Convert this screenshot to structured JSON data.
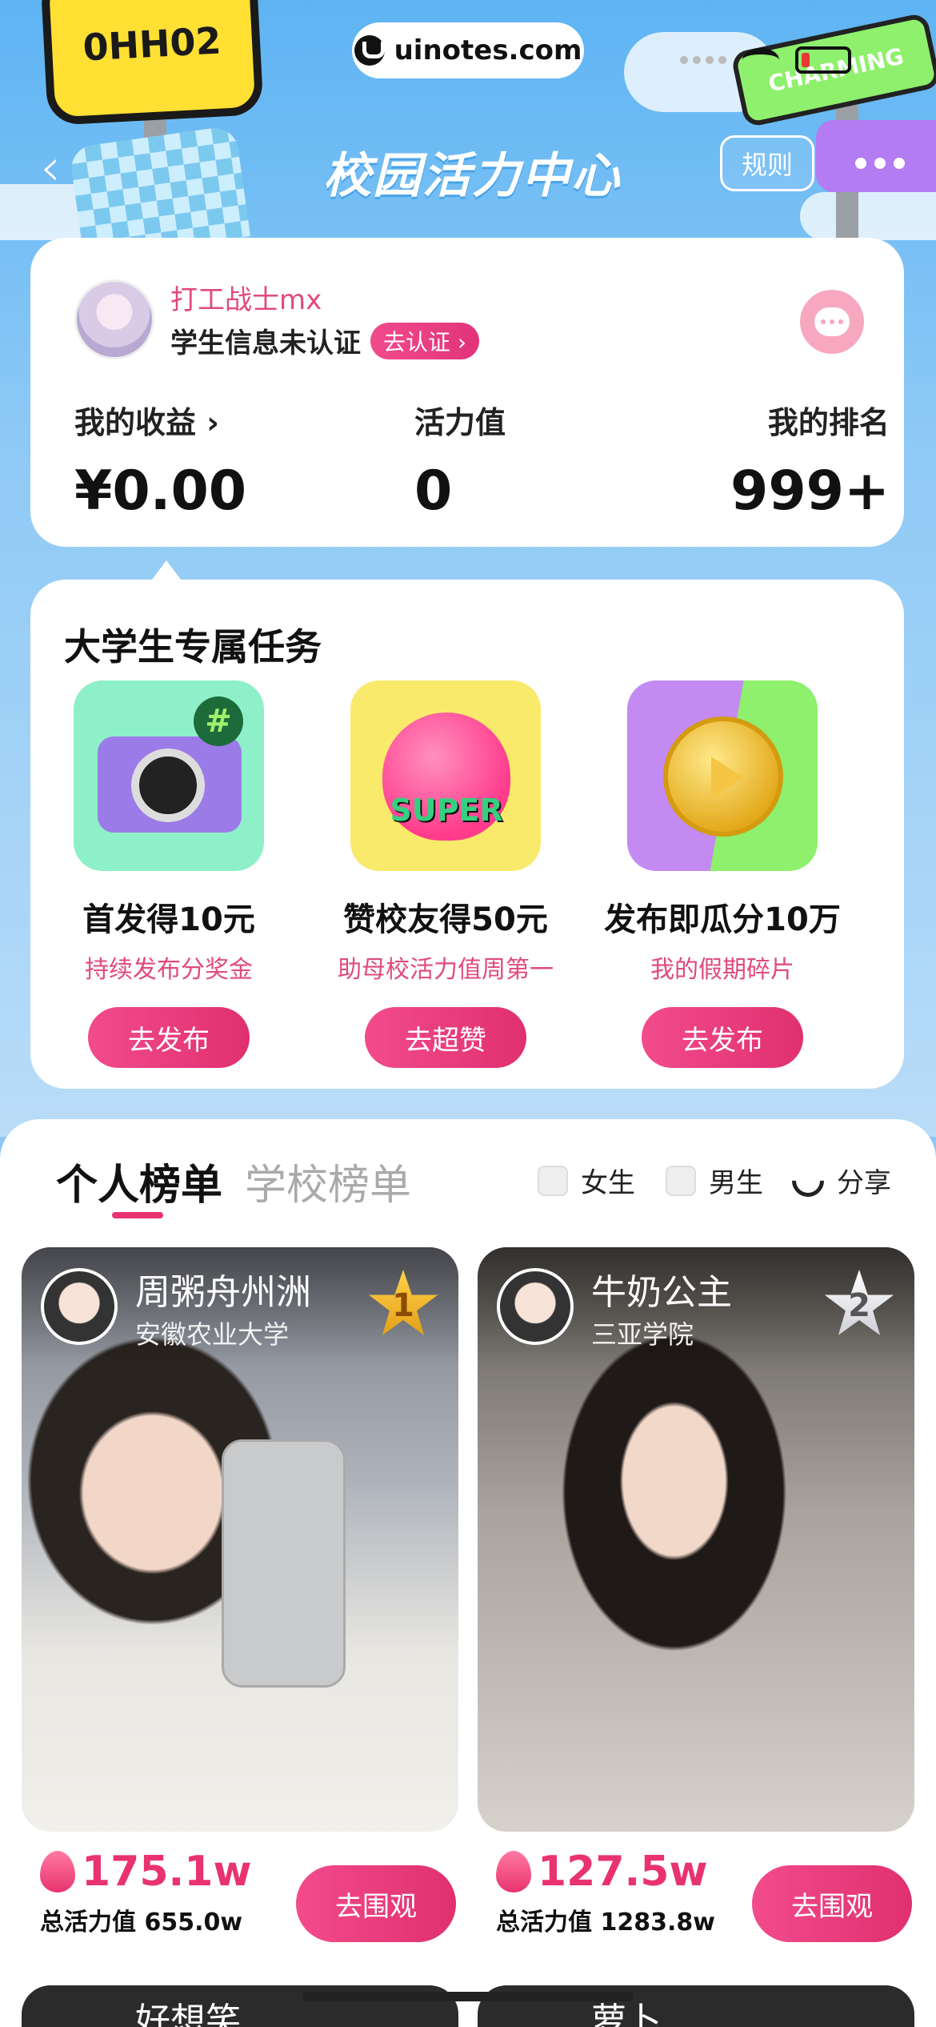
{
  "status_bar": {
    "url": "uinotes.com"
  },
  "decor": {
    "yellow_sign_text": "0HH02",
    "green_sign_text": "CHARMING"
  },
  "header": {
    "back_icon": "chevron-left-icon",
    "title": "校园活力中心",
    "rules_label": "规则"
  },
  "profile": {
    "username": "打工战士mx",
    "verify_status": "学生信息未认证",
    "verify_button": "去认证 ›",
    "stats": [
      {
        "label": "我的收益 ›",
        "value": "¥0.00"
      },
      {
        "label": "活力值",
        "value": "0"
      },
      {
        "label": "我的排名",
        "value": "999+"
      }
    ]
  },
  "tasks": {
    "title": "大学生专属任务",
    "items": [
      {
        "name": "首发得10元",
        "desc": "持续发布分奖金",
        "button": "去发布",
        "icon": "camera-icon"
      },
      {
        "name": "赞校友得50元",
        "desc": "助母校活力值周第一",
        "button": "去超赞",
        "icon": "super-heart-icon",
        "icon_text": "SUPER"
      },
      {
        "name": "发布即瓜分10万",
        "desc": "我的假期碎片",
        "button": "去发布",
        "icon": "gold-coin-icon"
      }
    ]
  },
  "board": {
    "tabs": [
      "个人榜单",
      "学校榜单"
    ],
    "active_tab": 0,
    "filters": [
      {
        "label": "女生",
        "checked": false
      },
      {
        "label": "男生",
        "checked": false
      }
    ],
    "share_label": "分享",
    "ranks": [
      {
        "rank": "1",
        "name": "周粥舟州洲",
        "school": "安徽农业大学",
        "score": "175.1w",
        "total": "总活力值 655.0w",
        "button": "去围观"
      },
      {
        "rank": "2",
        "name": "牛奶公主",
        "school": "三亚学院",
        "score": "127.5w",
        "total": "总活力值 1283.8w",
        "button": "去围观"
      }
    ],
    "peek": [
      {
        "name": "好想笑"
      },
      {
        "name": "萝卜"
      }
    ]
  },
  "colors": {
    "accent": "#e8336f",
    "background_top": "#5eb4f3",
    "card": "#ffffff"
  }
}
